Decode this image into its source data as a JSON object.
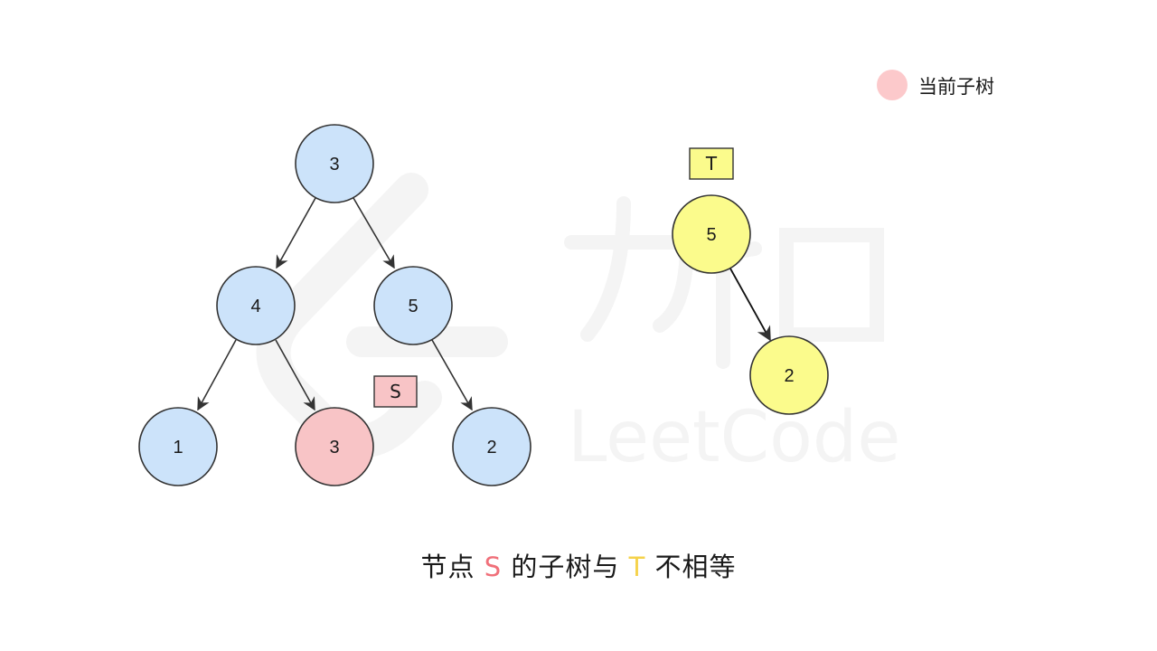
{
  "legend": {
    "label": "当前子树",
    "color": "#fcc9cb"
  },
  "watermark": {
    "text": "LeetCode",
    "logo_text": "力扣"
  },
  "tree_s": {
    "tag": "S",
    "tag_color": "#f8c4c6",
    "nodes": [
      {
        "id": "s-root",
        "value": "3",
        "fill": "#cce3fa"
      },
      {
        "id": "s-left",
        "value": "4",
        "fill": "#cce3fa"
      },
      {
        "id": "s-right",
        "value": "5",
        "fill": "#cce3fa"
      },
      {
        "id": "s-left-left",
        "value": "1",
        "fill": "#cce3fa"
      },
      {
        "id": "s-left-right",
        "value": "3",
        "fill": "#f8c4c6"
      },
      {
        "id": "s-right-right",
        "value": "2",
        "fill": "#cce3fa"
      }
    ],
    "edges": [
      [
        "s-root",
        "s-left"
      ],
      [
        "s-root",
        "s-right"
      ],
      [
        "s-left",
        "s-left-left"
      ],
      [
        "s-left",
        "s-left-right"
      ],
      [
        "s-right",
        "s-right-right"
      ]
    ]
  },
  "tree_t": {
    "tag": "T",
    "tag_color": "#fbfb8c",
    "nodes": [
      {
        "id": "t-root",
        "value": "5",
        "fill": "#fbfb8c"
      },
      {
        "id": "t-right",
        "value": "2",
        "fill": "#fbfb8c"
      }
    ],
    "edges": [
      [
        "t-root",
        "t-right"
      ]
    ]
  },
  "caption": {
    "part1": "节点",
    "s_letter": "S",
    "part2": "的子树与",
    "t_letter": "T",
    "part3": "不相等",
    "s_color": "#f0707a",
    "t_color": "#f5d24a"
  }
}
